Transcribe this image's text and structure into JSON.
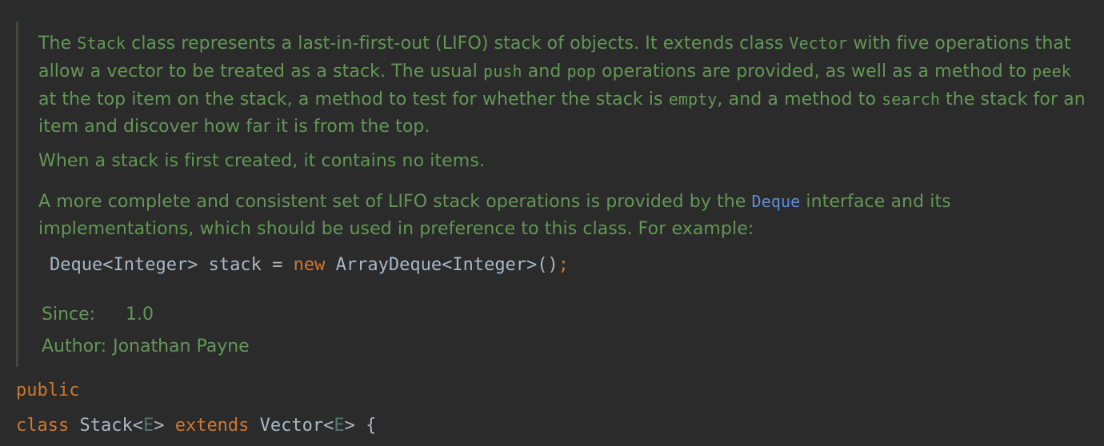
{
  "javadoc": {
    "p1": {
      "t1": "The ",
      "c_stack": "Stack",
      "t2": " class represents a last-in-first-out (LIFO) stack of objects. It extends class ",
      "c_vector": "Vector",
      "t3": " with five operations that allow a vector to be treated as a stack. The usual ",
      "c_push": "push",
      "t4": " and ",
      "c_pop": "pop",
      "t5": " operations are provided, as well as a method to ",
      "c_peek": "peek",
      "t6": " at the top item on the stack, a method to test for whether the stack is ",
      "c_empty": "empty",
      "t7": ", and a method to ",
      "c_search": "search",
      "t8": " the stack for an item and discover how far it is from the top."
    },
    "p2": "When a stack is first created, it contains no items.",
    "p3": {
      "t1": "A more complete and consistent set of LIFO stack operations is provided by the ",
      "link_deque": "Deque",
      "t2": " interface and its implementations, which should be used in preference to this class. For example:"
    },
    "example": {
      "part1": "Deque<Integer> stack = ",
      "kw_new": "new",
      "part2": " ArrayDeque<Integer>()",
      "semicolon": ";"
    },
    "since": {
      "label": "Since:",
      "value": "1.0"
    },
    "author": {
      "label": "Author:",
      "value": "Jonathan Payne"
    }
  },
  "code": {
    "line1": "public",
    "line2": {
      "kw_class": "class",
      "name": " Stack<",
      "tp1": "E",
      "mid": "> ",
      "kw_extends": "extends",
      "vector": " Vector<",
      "tp2": "E",
      "end": "> {"
    }
  },
  "colors": {
    "background": "#2b2b2b",
    "doc_text": "#629755",
    "link": "#5b8fd8",
    "keyword": "#cc7832",
    "identifier": "#a9b7c6",
    "type_param": "#507874"
  }
}
